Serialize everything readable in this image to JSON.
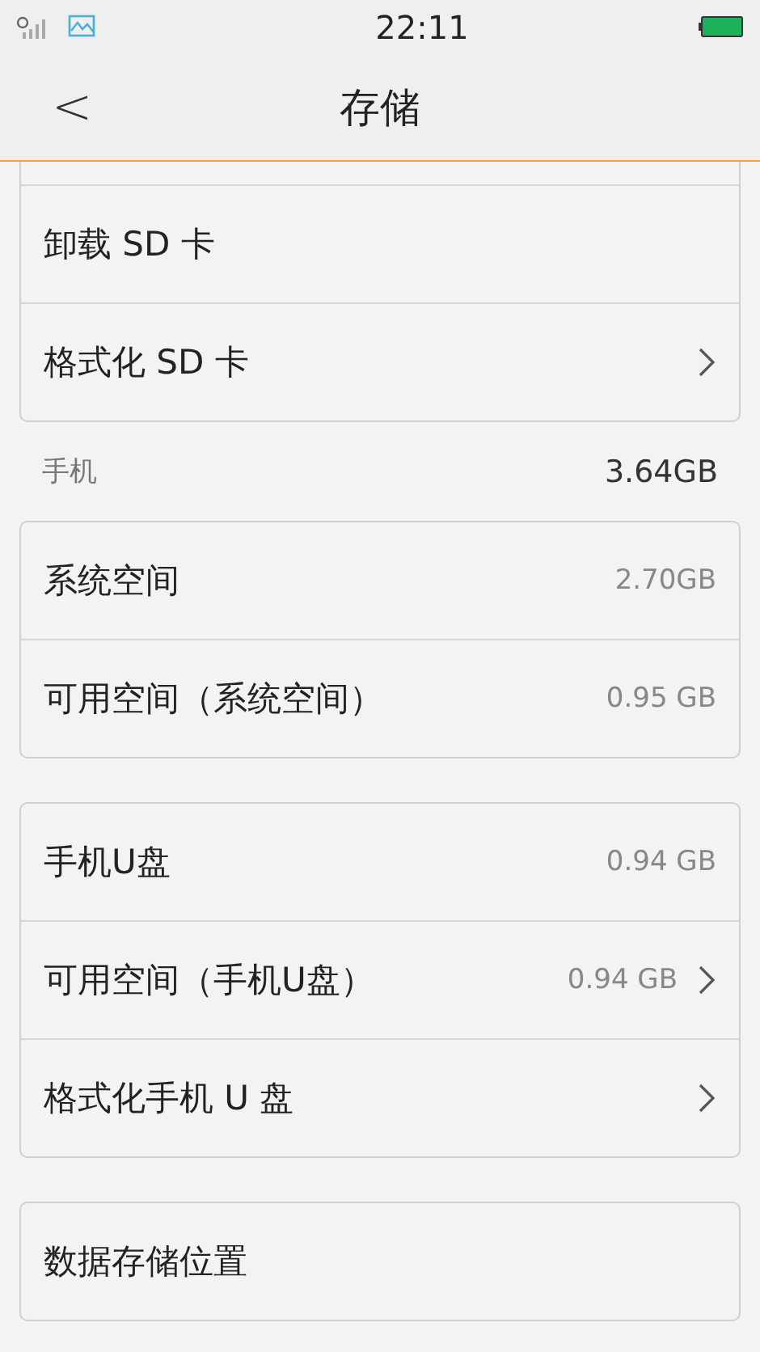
{
  "status_bar": {
    "time": "22:11"
  },
  "header": {
    "back_icon": "<",
    "title": "存储"
  },
  "groups": [
    {
      "cut_top": true,
      "rows": [
        {
          "label": "卸载 SD 卡",
          "chevron": false
        },
        {
          "label": "格式化 SD 卡",
          "chevron": true
        }
      ]
    },
    {
      "section": {
        "label": "手机",
        "value": "3.64GB"
      },
      "rows": [
        {
          "label": "系统空间",
          "value": "2.70GB",
          "chevron": false
        },
        {
          "label": "可用空间（系统空间）",
          "value": "0.95 GB",
          "chevron": false
        }
      ]
    },
    {
      "rows": [
        {
          "label": "手机U盘",
          "value": "0.94 GB",
          "chevron": false
        },
        {
          "label": "可用空间（手机U盘）",
          "value": "0.94 GB",
          "chevron": true
        },
        {
          "label": "格式化手机 U 盘",
          "chevron": true
        }
      ]
    },
    {
      "rows": [
        {
          "label": "数据存储位置",
          "chevron": false
        }
      ]
    }
  ]
}
